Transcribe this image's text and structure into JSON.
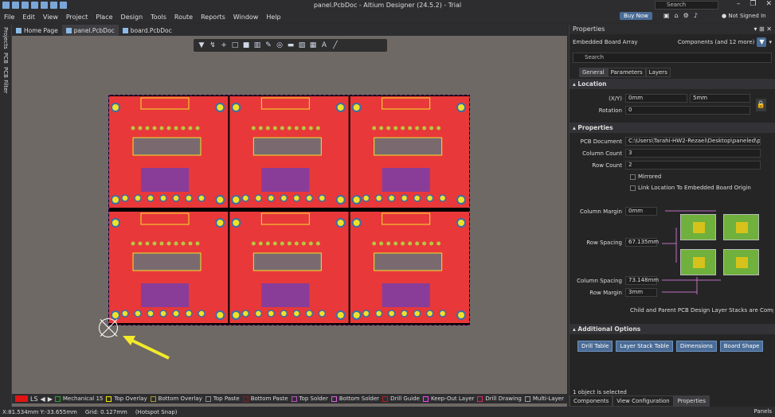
{
  "window": {
    "title": "panel.PcbDoc - Altium Designer (24.5.2) - Trial",
    "search_placeholder": "Search",
    "controls": [
      "–",
      "❐",
      "✕"
    ]
  },
  "menu": [
    "File",
    "Edit",
    "View",
    "Project",
    "Place",
    "Design",
    "Tools",
    "Route",
    "Reports",
    "Window",
    "Help"
  ],
  "header_right": {
    "buy_now": "Buy Now",
    "signin": "Not Signed In"
  },
  "left_rail": [
    "Projects",
    "PCB",
    "PCB Filter"
  ],
  "doc_tabs": [
    "Home Page",
    "panel.PcbDoc",
    "board.PcbDoc"
  ],
  "toolbar_icons": [
    "filter-icon",
    "route-icon",
    "plus-icon",
    "select-rect-icon",
    "place-component-icon",
    "chart-icon",
    "pen-icon",
    "via-icon",
    "fill-icon",
    "polygon-icon",
    "region-icon",
    "text-icon",
    "line-icon"
  ],
  "layers": {
    "current": "LS",
    "items": [
      {
        "name": "Mechanical 15",
        "color": "#2ca82c"
      },
      {
        "name": "Top Overlay",
        "color": "#f2e600"
      },
      {
        "name": "Bottom Overlay",
        "color": "#a89c2c"
      },
      {
        "name": "Top Paste",
        "color": "#8c8c8c"
      },
      {
        "name": "Bottom Paste",
        "color": "#8b1a1a"
      },
      {
        "name": "Top Solder",
        "color": "#c050c0"
      },
      {
        "name": "Bottom Solder",
        "color": "#e060e0"
      },
      {
        "name": "Drill Guide",
        "color": "#b02020"
      },
      {
        "name": "Keep-Out Layer",
        "color": "#ff40ff"
      },
      {
        "name": "Drill Drawing",
        "color": "#e02a5a"
      },
      {
        "name": "Multi-Layer",
        "color": "#9c9c9c"
      }
    ]
  },
  "status": {
    "coords": "X:81.534mm Y:-33.655mm",
    "grid": "Grid: 0.127mm",
    "snap": "(Hotspot Snap)",
    "panels": "Panels"
  },
  "properties": {
    "title": "Properties",
    "object_type": "Embedded Board Array",
    "filter_summary": "Components (and 12 more)",
    "search_placeholder": "Search",
    "tabs": [
      "General",
      "Parameters",
      "Layers"
    ],
    "location": {
      "heading": "Location",
      "xy_label": "(X/Y)",
      "x": "0mm",
      "y": "5mm",
      "rotation_label": "Rotation",
      "rotation": "0"
    },
    "props": {
      "heading": "Properties",
      "pcb_document_label": "PCB Document",
      "pcb_document": "C:\\Users\\Tarahi-HW2-Rezaei\\Desktop\\paneled\\pc",
      "column_count_label": "Column Count",
      "column_count": "3",
      "row_count_label": "Row Count",
      "row_count": "2",
      "mirrored": "Mirrored",
      "link_location": "Link Location To Embedded Board Origin"
    },
    "spacing": {
      "column_margin_label": "Column Margin",
      "column_margin": "0mm",
      "row_spacing_label": "Row Spacing",
      "row_spacing": "67.135mm",
      "column_spacing_label": "Column Spacing",
      "column_spacing": "73.148mm",
      "row_margin_label": "Row Margin",
      "row_margin": "3mm"
    },
    "compat_note": "Child and Parent PCB Design Layer Stacks are Compatib",
    "additional": {
      "heading": "Additional Options",
      "buttons": [
        "Drill Table",
        "Layer Stack Table",
        "Dimensions",
        "Board Shape"
      ]
    },
    "selection_info": "1 object is selected",
    "bottom_tabs": [
      "Components",
      "View Configuration",
      "Properties"
    ]
  },
  "colors": {
    "board_red": "#e8383a",
    "board_yellow": "#f0e22a",
    "board_purple": "#6a3fb8",
    "arrow": "#f3ea2a",
    "accent": "#4a6c96"
  }
}
